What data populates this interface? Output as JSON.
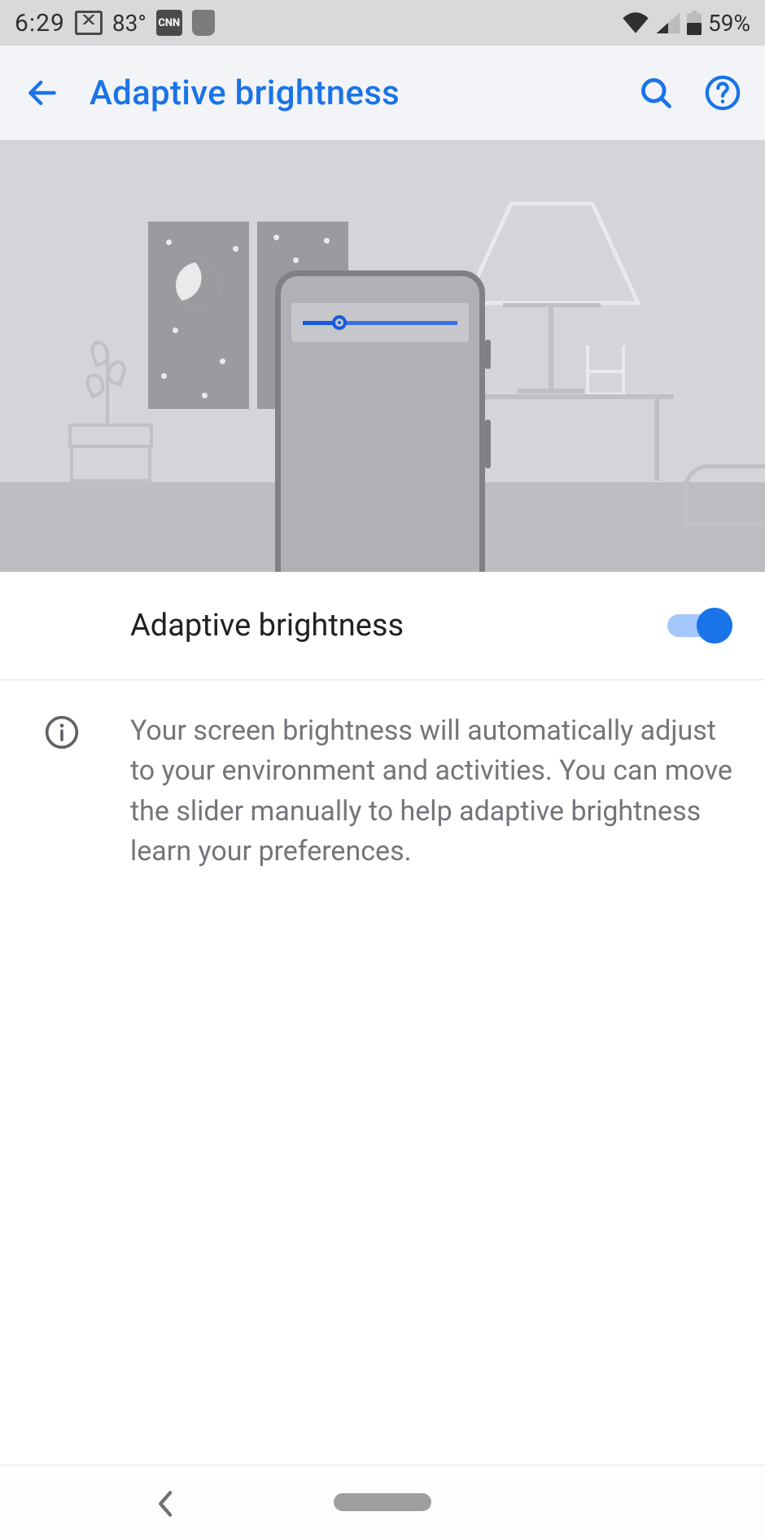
{
  "status": {
    "time": "6:29",
    "temperature": "83°",
    "battery_percent": "59%",
    "cnn_label": "CNN"
  },
  "appbar": {
    "title": "Adaptive brightness"
  },
  "setting": {
    "toggle_label": "Adaptive brightness",
    "toggle_on": true
  },
  "info": {
    "description": "Your screen brightness will automatically adjust to your environment and activities. You can move the slider manually to help adaptive brightness learn your preferences."
  }
}
